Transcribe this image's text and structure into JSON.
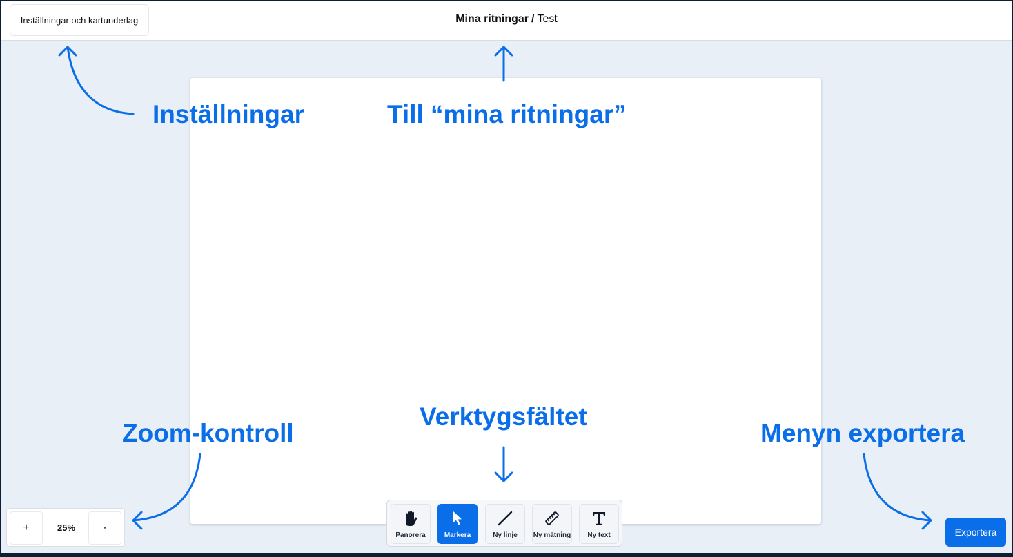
{
  "header": {
    "settings_button": "Inställningar och kartunderlag",
    "breadcrumb_root": "Mina ritningar",
    "breadcrumb_separator": "/",
    "breadcrumb_current": "Test"
  },
  "annotations": {
    "settings": "Inställningar",
    "my_drawings": "Till “mina ritningar”",
    "zoom": "Zoom-kontroll",
    "toolbar": "Verktygsfältet",
    "export": "Menyn exportera"
  },
  "zoom": {
    "plus_label": "+",
    "level": "25%",
    "minus_label": "-"
  },
  "toolbar": {
    "tools": [
      {
        "label": "Panorera",
        "icon": "hand-icon",
        "active": false
      },
      {
        "label": "Markera",
        "icon": "cursor-arrow-icon",
        "active": true
      },
      {
        "label": "Ny linje",
        "icon": "line-icon",
        "active": false
      },
      {
        "label": "Ny mätning",
        "icon": "ruler-icon",
        "active": false
      },
      {
        "label": "Ny text",
        "icon": "text-t-icon",
        "active": false
      }
    ]
  },
  "export": {
    "label": "Exportera"
  },
  "colors": {
    "accent": "#0a6ee8",
    "background": "#e9eff7",
    "frame": "#0f1f33"
  }
}
